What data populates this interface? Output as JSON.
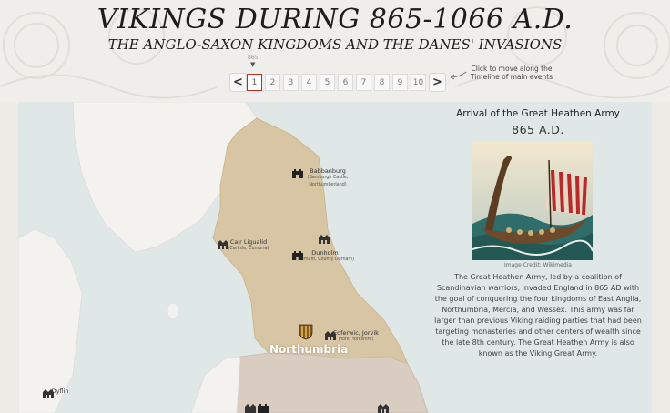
{
  "header": {
    "title": "VIKINGS DURING 865-1066 A.D.",
    "subtitle": "THE ANGLO-SAXON KINGDOMS AND THE DANES' INVASIONS"
  },
  "timeline": {
    "year_label": "865",
    "prev_label": "<",
    "next_label": ">",
    "pages": [
      "1",
      "2",
      "3",
      "4",
      "5",
      "6",
      "7",
      "8",
      "9",
      "10"
    ],
    "selected_page": "1",
    "hint": "Click to move along the Timeline of main events"
  },
  "map": {
    "places": [
      {
        "name": "Babbanburg",
        "sub": "(Bamburgh Castle, Northumberland)",
        "icon": "castle-icon"
      },
      {
        "name": "Cair Ligualid",
        "sub": "(Carlisle, Cumbria)",
        "icon": "settlement-icon"
      },
      {
        "name": "Dunholm",
        "sub": "(Durham, County Durham)",
        "icon": "castle-icon"
      },
      {
        "name": "Eoferwic, Jorvik",
        "sub": "(York, Yorkshire)",
        "icon": "settlement-icon"
      },
      {
        "name": "Dyflin",
        "sub": "",
        "icon": "settlement-icon"
      }
    ],
    "kingdom_label": "Northumbria",
    "colors": {
      "sea": "#dfe8e6",
      "land": "#f3f2ee",
      "northumbria": "#d8c5a4",
      "mercia": "#d9ccc0",
      "shield": "#8a5a1f"
    }
  },
  "event": {
    "title": "Arrival of the Great Heathen Army",
    "year": "865 A.D.",
    "image_credit": "Image Credit: Wikimedia",
    "description": "The Great Heathen Army, led by a coalition of Scandinavian warriors, invaded England in 865 AD with the goal of conquering the four kingdoms of East Anglia, Northumbria, Mercia, and Wessex. This army was far larger than previous Viking raiding parties that had been targeting monasteries and other centers of wealth since the late 8th century. The Great Heathen Army is also known as the Viking Great Army."
  }
}
